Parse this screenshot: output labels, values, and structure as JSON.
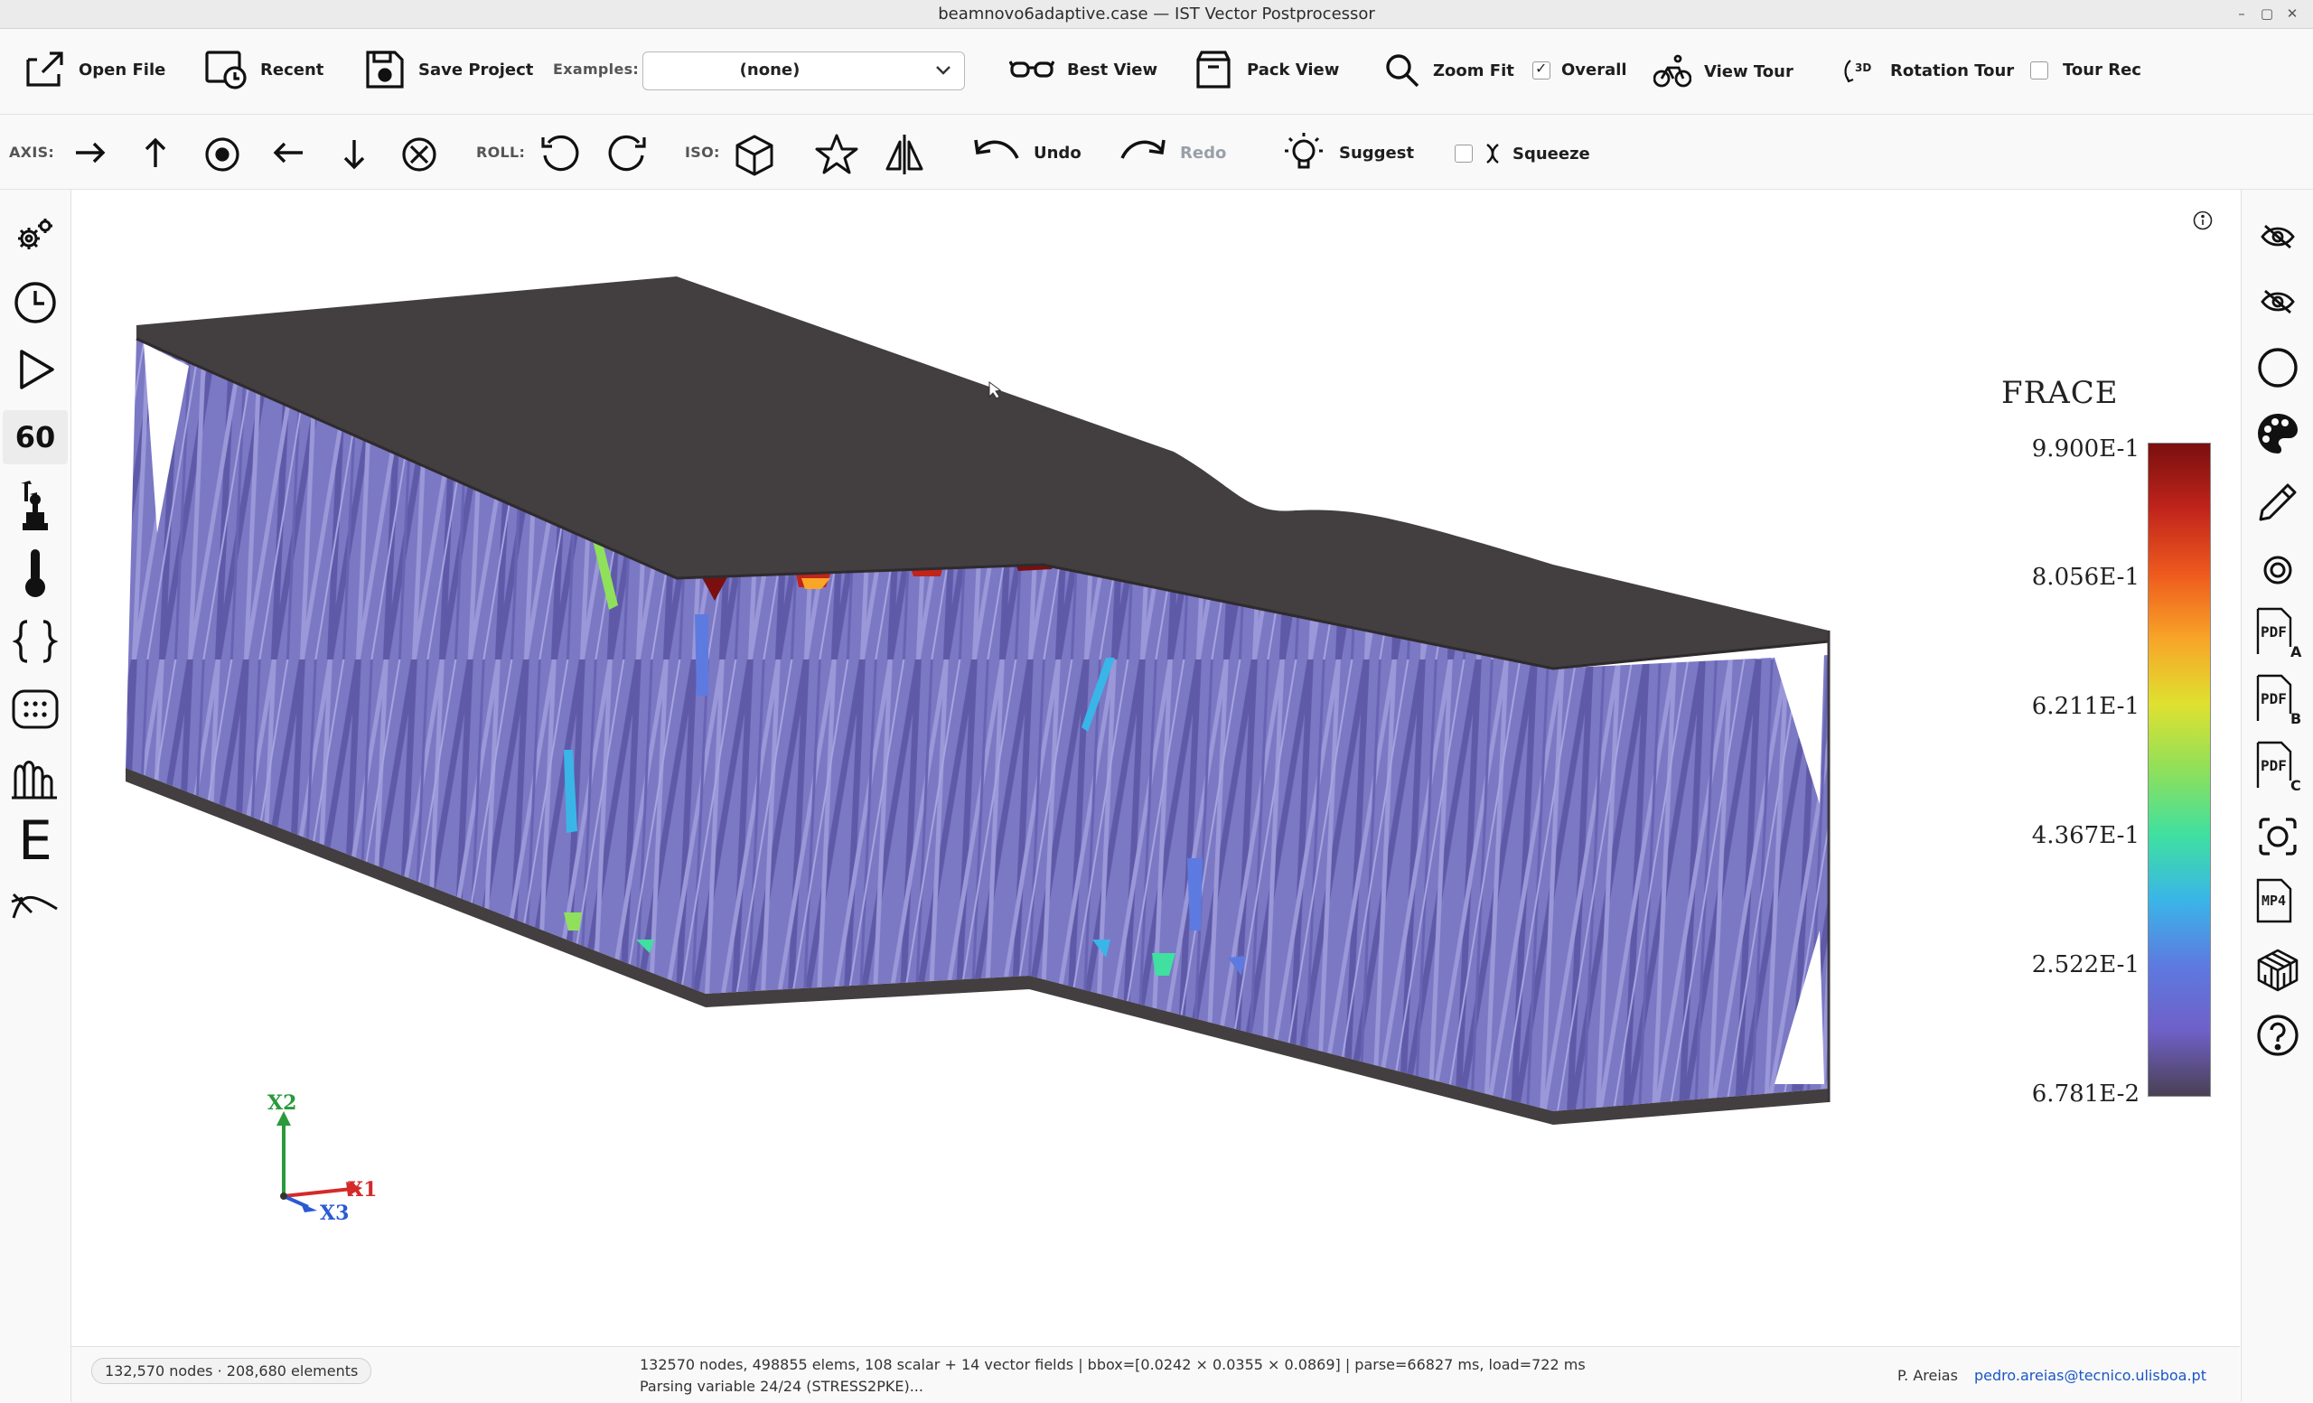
{
  "window": {
    "title": "beamnovo6adaptive.case — IST Vector Postprocessor",
    "controls": [
      "–",
      "▢",
      "✕"
    ]
  },
  "toolbar1": {
    "open_file": "Open File",
    "recent": "Recent",
    "save_project": "Save Project",
    "examples_label": "Examples:",
    "examples_value": "(none)",
    "best_view": "Best View",
    "pack_view": "Pack View",
    "zoom_fit": "Zoom Fit",
    "overall": "Overall",
    "overall_checked": true,
    "view_tour": "View Tour",
    "rotation_tour": "Rotation Tour",
    "rotation_badge": "3D",
    "tour_rec": "Tour Rec",
    "tour_rec_checked": false
  },
  "toolbar2": {
    "axis_label": "AXIS:",
    "roll_label": "ROLL:",
    "iso_label": "ISO:",
    "undo": "Undo",
    "redo": "Redo",
    "suggest": "Suggest",
    "squeeze": "Squeeze",
    "squeeze_checked": false
  },
  "left_sidebar": {
    "fps_value": "60",
    "icons": [
      "gears-icon",
      "clock-icon",
      "play-icon",
      "fps-counter",
      "statue-icon",
      "thermometer-icon",
      "braces-icon",
      "grid-dots-icon",
      "fingers-icon",
      "e-letter-icon",
      "curve-icon"
    ]
  },
  "right_sidebar": {
    "pdf_text": "PDF",
    "pdf_a": "A",
    "pdf_b": "B",
    "pdf_c": "C",
    "mp4_text": "MP4"
  },
  "viewport": {
    "legend": {
      "title": "FRACE",
      "ticks": [
        "9.900E-1",
        "8.056E-1",
        "6.211E-1",
        "4.367E-1",
        "2.522E-1",
        "6.781E-2"
      ],
      "colors": [
        "#7a0f0f",
        "#c0241b",
        "#ee5a1e",
        "#f8a528",
        "#dfe130",
        "#8fe05a",
        "#3fe0a0",
        "#3ab5e8",
        "#5d7ae0",
        "#6f60c8",
        "#4a4154"
      ]
    },
    "triad": {
      "x1": "X1",
      "x2": "X2",
      "x3": "X3",
      "x1_color": "#d42a2a",
      "x2_color": "#2a9a3a",
      "x3_color": "#2a5ad4"
    },
    "model_colors": {
      "plate": "#433e40",
      "lattice": "#7b78c4",
      "lattice_dark": "#5f5aa8"
    }
  },
  "statusbar": {
    "counts_pill": "132,570 nodes · 208,680 elements",
    "line1": "132570 nodes, 498855 elems, 108 scalar + 14 vector fields  |  bbox=[0.0242 × 0.0355 × 0.0869]  |  parse=66827 ms, load=722 ms",
    "line2": "Parsing variable 24/24 (STRESS2PKE)...",
    "author": "P. Areias",
    "email": "pedro.areias@tecnico.ulisboa.pt",
    "email_color": "#1a56c8"
  }
}
